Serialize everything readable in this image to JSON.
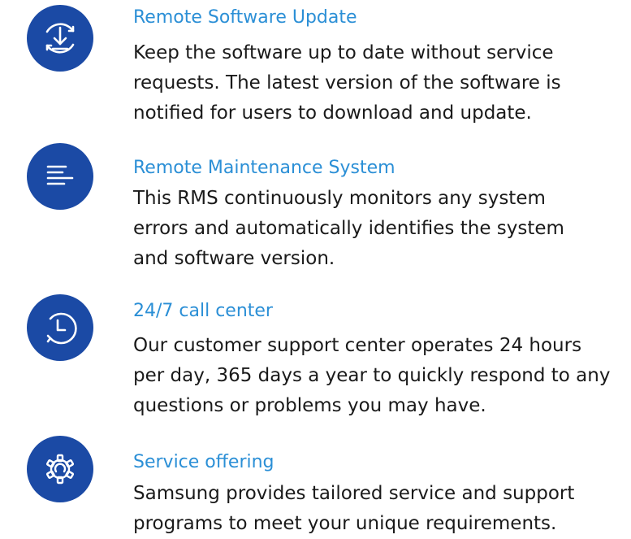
{
  "features": [
    {
      "icon": "download-update-icon",
      "title": "Remote Software Update",
      "lines": [
        "Keep the software up to date without service",
        "requests. The latest version of the software is",
        "notified for users to download and update."
      ]
    },
    {
      "icon": "text-lines-icon",
      "title": "Remote Maintenance System",
      "lines": [
        "This RMS continuously monitors any system",
        "errors and automatically identifies the system",
        "and software version."
      ]
    },
    {
      "icon": "clock-history-icon",
      "title": "24/7 call center",
      "lines": [
        "Our customer support center operates 24 hours",
        "per day, 365 days a year to quickly respond to any",
        "questions or problems you may have."
      ]
    },
    {
      "icon": "gear-icon",
      "title": "Service offering",
      "lines": [
        "Samsung provides tailored service and support",
        "programs to meet your unique requirements."
      ]
    }
  ],
  "colors": {
    "icon_background": "#1b4aa5",
    "title": "#2b8fd6",
    "body_text": "#1a1a1a"
  }
}
